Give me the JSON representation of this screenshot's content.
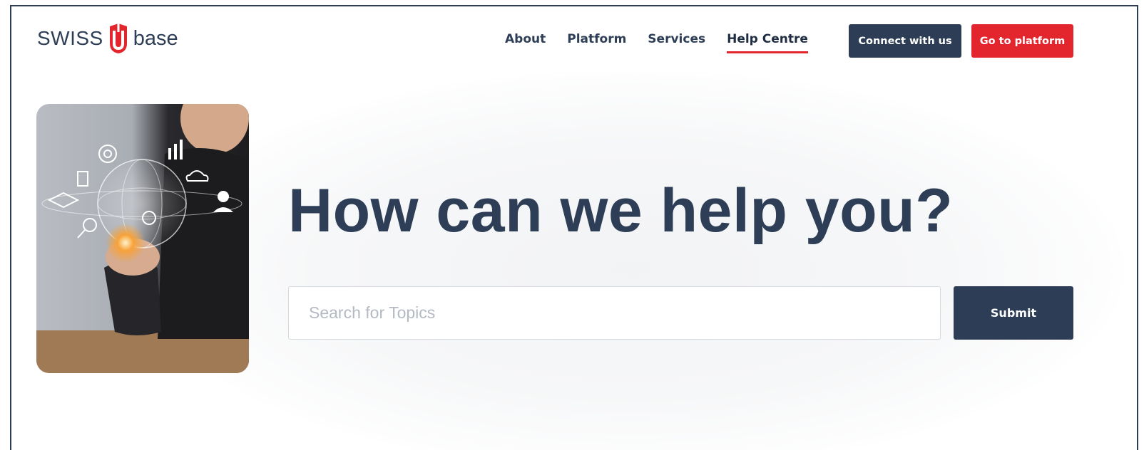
{
  "brand": {
    "name_left": "SWISS",
    "name_right": "base",
    "accent_color": "#e3262e",
    "primary_color": "#2c3d55"
  },
  "nav": {
    "items": [
      {
        "label": "About"
      },
      {
        "label": "Platform"
      },
      {
        "label": "Services"
      },
      {
        "label": "Help Centre",
        "active": true
      }
    ]
  },
  "header_buttons": {
    "connect_label": "Connect with us",
    "platform_label": "Go to platform"
  },
  "hero": {
    "headline": "How can we help you?",
    "image_icon": "hand-holding-globe-photo"
  },
  "search": {
    "placeholder": "Search for Topics",
    "value": "",
    "submit_label": "Submit"
  }
}
